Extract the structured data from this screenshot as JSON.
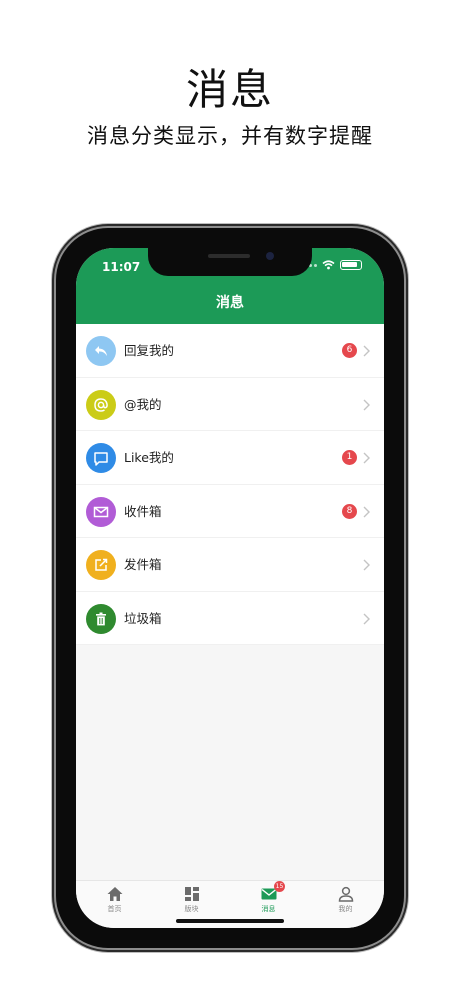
{
  "hero": {
    "title": "消息",
    "subtitle": "消息分类显示，并有数字提醒"
  },
  "status_bar": {
    "time": "11:07"
  },
  "header": {
    "title": "消息"
  },
  "menu": [
    {
      "label": "回复我的",
      "badge": "6",
      "icon": "reply-icon",
      "color": "#8ec7f2"
    },
    {
      "label": "@我的",
      "badge": "",
      "icon": "at-icon",
      "color": "#cbcc17"
    },
    {
      "label": "Like我的",
      "badge": "1",
      "icon": "chat-bubble-icon",
      "color": "#2f8be6"
    },
    {
      "label": "收件箱",
      "badge": "8",
      "icon": "mail-icon",
      "color": "#b15cd6"
    },
    {
      "label": "发件箱",
      "badge": "",
      "icon": "compose-icon",
      "color": "#f0b01e"
    },
    {
      "label": "垃圾箱",
      "badge": "",
      "icon": "trash-icon",
      "color": "#2f8a2f"
    }
  ],
  "tabbar": {
    "tabs": [
      {
        "label": "首页",
        "icon": "home-icon"
      },
      {
        "label": "版块",
        "icon": "grid-icon"
      },
      {
        "label": "消息",
        "icon": "mail-icon",
        "badge": "15"
      },
      {
        "label": "我的",
        "icon": "person-icon"
      }
    ]
  },
  "colors": {
    "brand_green": "#1c9a57",
    "badge_red": "#e5484d"
  }
}
